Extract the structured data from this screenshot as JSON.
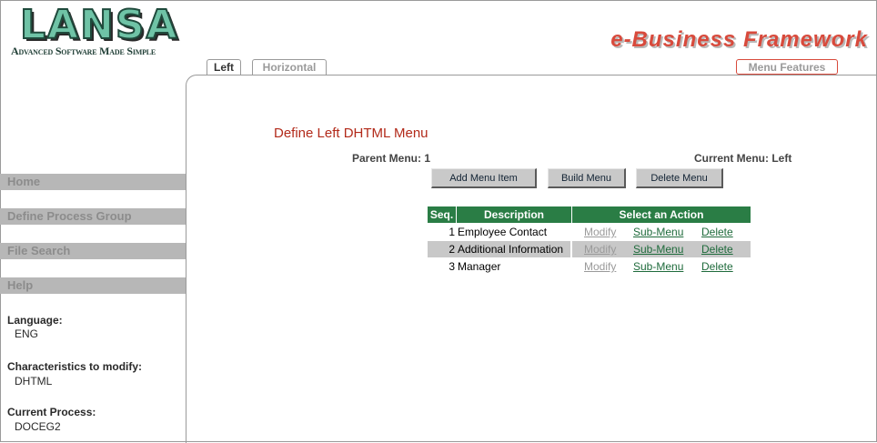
{
  "header": {
    "logo_text": "LANSA",
    "logo_tagline": "Advanced Software Made Simple",
    "brand_title": "e-Business Framework"
  },
  "tabs": [
    {
      "label": "Left",
      "active": true
    },
    {
      "label": "Horizontal",
      "active": false
    }
  ],
  "menu_features_label": "Menu Features",
  "sidebar": {
    "nav": [
      {
        "label": "Home"
      },
      {
        "label": "Define Process Group"
      },
      {
        "label": "File Search"
      },
      {
        "label": "Help"
      }
    ],
    "info": [
      {
        "label": "Language:",
        "value": "ENG"
      },
      {
        "label": "Characteristics to modify:",
        "value": "DHTML"
      },
      {
        "label": "Current Process:",
        "value": "DOCEG2"
      }
    ]
  },
  "main": {
    "title": "Define Left DHTML Menu",
    "parent_menu": "Parent Menu: 1",
    "current_menu": "Current Menu: Left",
    "buttons": {
      "add": "Add Menu Item",
      "build": "Build Menu",
      "delete": "Delete Menu"
    },
    "table": {
      "headers": [
        "Seq.",
        "Description",
        "Select an Action"
      ],
      "rows": [
        {
          "seq": "1",
          "description": "Employee Contact",
          "modify": "Modify",
          "submenu": "Sub-Menu",
          "delete": "Delete"
        },
        {
          "seq": "2",
          "description": "Additional Information",
          "modify": "Modify",
          "submenu": "Sub-Menu",
          "delete": "Delete"
        },
        {
          "seq": "3",
          "description": "Manager",
          "modify": "Modify",
          "submenu": "Sub-Menu",
          "delete": "Delete"
        }
      ]
    }
  },
  "colors": {
    "accent_red": "#d84a3c",
    "title_red": "#b22a1a",
    "table_header_green": "#2a7d45",
    "nav_gray": "#b7b7b7"
  }
}
